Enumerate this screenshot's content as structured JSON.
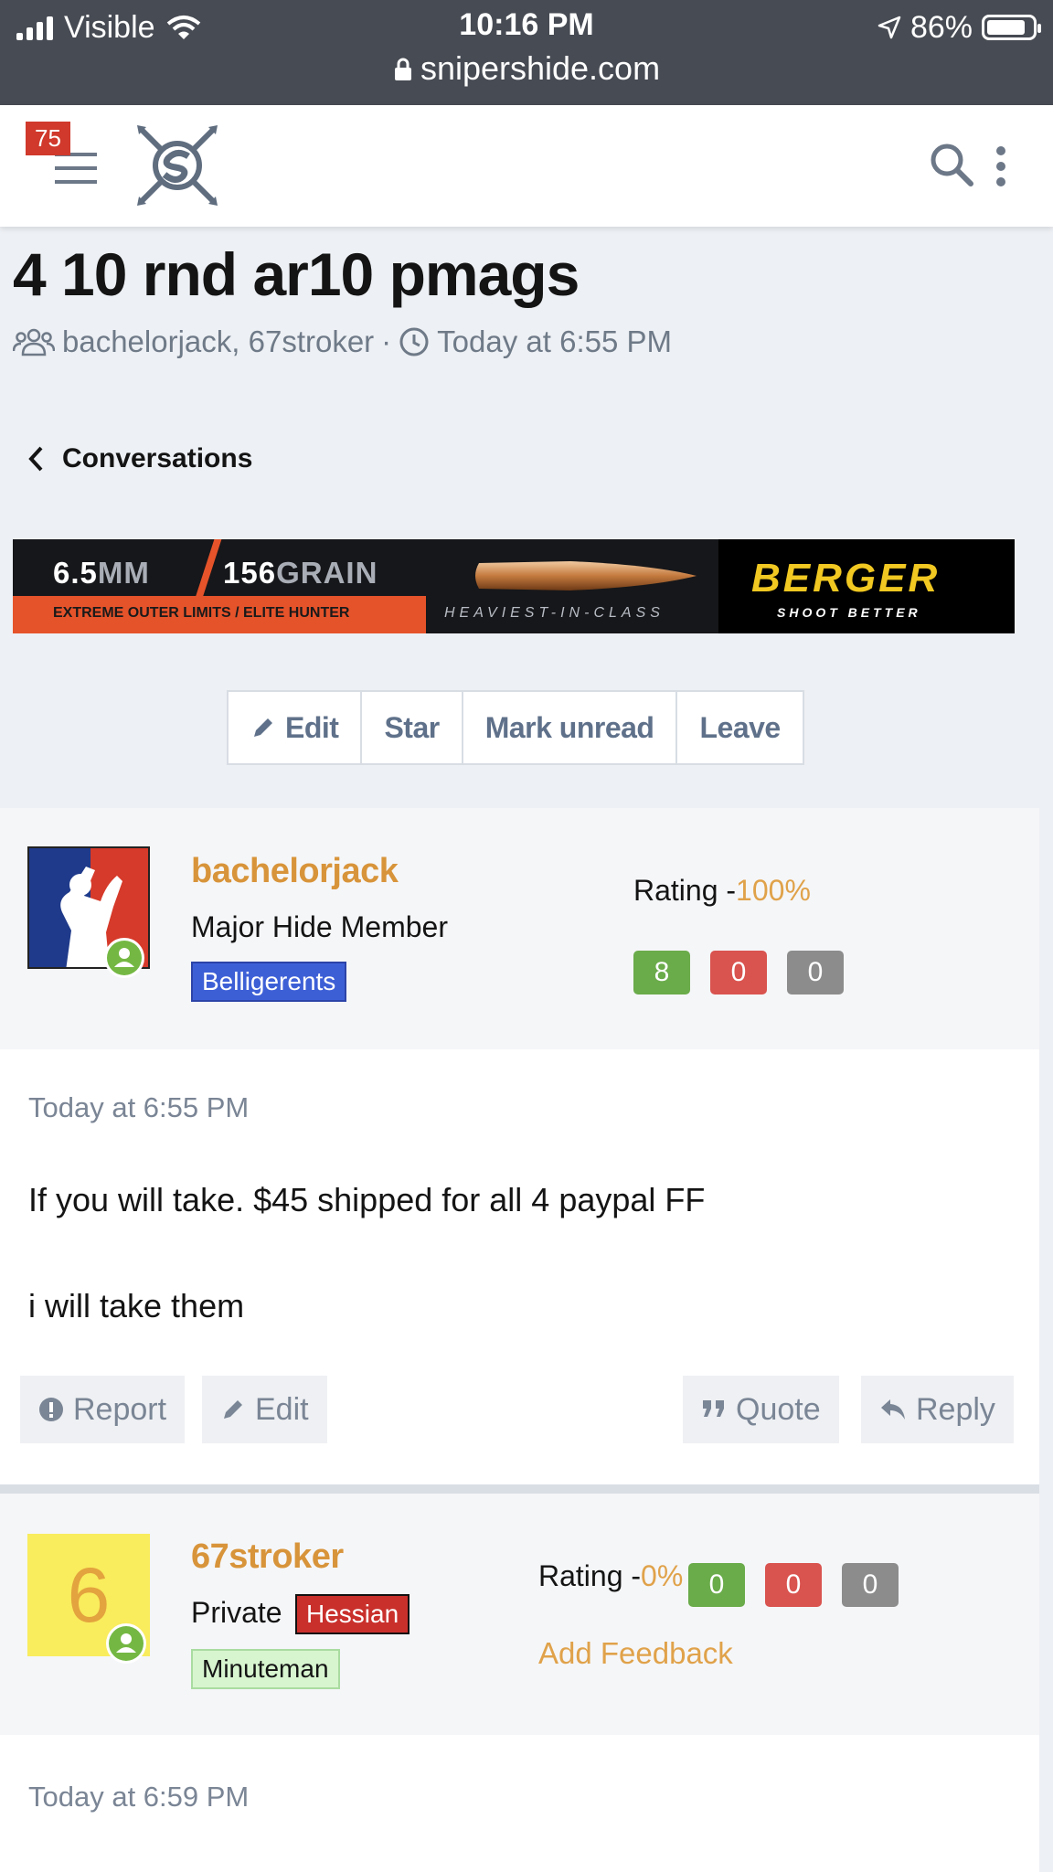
{
  "status_bar": {
    "carrier": "Visible",
    "time": "10:16 PM",
    "url": "snipershide.com",
    "battery": "86%",
    "battery_level": 0.86
  },
  "header": {
    "notification_count": "75"
  },
  "conversation": {
    "title": "4 10 rnd ar10 pmags",
    "participants": "bachelorjack, 67stroker",
    "separator": "·",
    "date": "Today at 6:55 PM",
    "back_label": "Conversations"
  },
  "banner": {
    "caliber_num": "6.5",
    "caliber_unit": "MM",
    "grain_num": "156",
    "grain_unit": "GRAIN",
    "lines": "EXTREME OUTER LIMITS  /  ELITE HUNTER",
    "tagline": "HEAVIEST-IN-CLASS",
    "brand": "BERGER",
    "slogan": "SHOOT BETTER"
  },
  "actions": {
    "edit": "Edit",
    "star": "Star",
    "mark_unread": "Mark unread",
    "leave": "Leave"
  },
  "posts": [
    {
      "username": "bachelorjack",
      "user_title": "Major Hide Member",
      "banner": "Belligerents",
      "rating_label": "Rating -",
      "rating_value": "100%",
      "feedback": [
        "8",
        "0",
        "0"
      ],
      "time": "Today at 6:55 PM",
      "message_lines": [
        "If you will take. $45 shipped for all 4 paypal FF",
        "i will take them"
      ],
      "buttons": {
        "report": "Report",
        "edit": "Edit",
        "quote": "Quote",
        "reply": "Reply"
      }
    },
    {
      "username": "67stroker",
      "avatar_letter": "6",
      "user_title": "Private",
      "badge": "Hessian",
      "banner": "Minuteman",
      "rating_label": "Rating -",
      "rating_value": "0%",
      "feedback": [
        "0",
        "0",
        "0"
      ],
      "add_feedback": "Add Feedback",
      "time": "Today at 6:59 PM"
    }
  ],
  "colors": {
    "status_bar_bg": "#474b53",
    "username": "#d8943a",
    "positive": "#6aab4a",
    "negative": "#d9534f",
    "neutral": "#8c8c8c",
    "belligerents": "#3d5fd6",
    "hessian": "#c9302c",
    "minuteman": "#d7f5cf"
  }
}
